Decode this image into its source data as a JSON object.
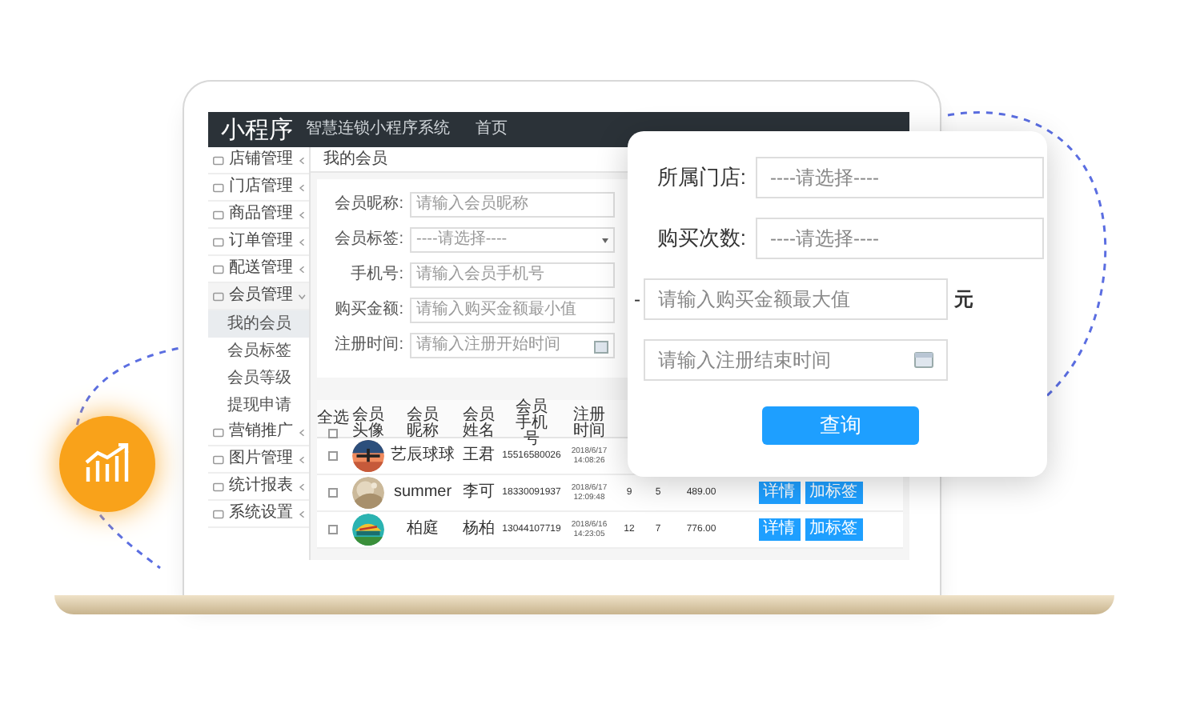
{
  "app": {
    "logo": "小程序",
    "subtitle": "智慧连锁小程序系统",
    "nav": "首页"
  },
  "sidebar": {
    "items": [
      {
        "label": "店铺管理",
        "expanded": false
      },
      {
        "label": "门店管理",
        "expanded": false
      },
      {
        "label": "商品管理",
        "expanded": false
      },
      {
        "label": "订单管理",
        "expanded": false
      },
      {
        "label": "配送管理",
        "expanded": false
      },
      {
        "label": "会员管理",
        "expanded": true,
        "children": [
          {
            "label": "我的会员",
            "selected": true
          },
          {
            "label": "会员标签",
            "selected": false
          },
          {
            "label": "会员等级",
            "selected": false
          },
          {
            "label": "提现申请",
            "selected": false
          }
        ]
      },
      {
        "label": "营销推广",
        "expanded": false
      },
      {
        "label": "图片管理",
        "expanded": false
      },
      {
        "label": "统计报表",
        "expanded": false
      },
      {
        "label": "系统设置",
        "expanded": false
      }
    ]
  },
  "breadcrumb": "我的会员",
  "filter_form": {
    "fields": [
      {
        "label": "会员昵称:",
        "placeholder": "请输入会员昵称",
        "kind": "text"
      },
      {
        "label": "会员标签:",
        "placeholder": "----请选择----",
        "kind": "select"
      },
      {
        "label": "手机号:",
        "placeholder": "请输入会员手机号",
        "kind": "text"
      },
      {
        "label": "购买金额:",
        "placeholder": "请输入购买金额最小值",
        "kind": "text"
      },
      {
        "label": "注册时间:",
        "placeholder": "请输入注册开始时间",
        "kind": "date"
      }
    ]
  },
  "table": {
    "select_all": {
      "label": "全选",
      "checked": false
    },
    "columns": [
      "会员头像",
      "会员昵称",
      "会员姓名",
      "会员手机号",
      "注册时间"
    ],
    "rows": [
      {
        "checked": false,
        "nickname": "艺辰球球",
        "name": "王君",
        "phone": "15516580026",
        "registered": "2018/6/17 14:08:26"
      },
      {
        "checked": false,
        "nickname": "summer",
        "name": "李可",
        "phone": "18330091937",
        "registered": "2018/6/17 12:09:48",
        "column_7": "9",
        "column_8": "5",
        "column_9": "489.00",
        "actions": [
          "详情",
          "加标签"
        ]
      },
      {
        "checked": false,
        "nickname": "柏庭",
        "name": "杨柏",
        "phone": "13044107719",
        "registered": "2018/6/16 14:23:05",
        "column_7": "12",
        "column_8": "7",
        "column_9": "776.00",
        "actions": [
          "详情",
          "加标签"
        ]
      }
    ]
  },
  "popup": {
    "fields": [
      {
        "label": "所属门店:",
        "placeholder": "----请选择----",
        "kind": "select"
      },
      {
        "label": "购买次数:",
        "placeholder": "----请选择----",
        "kind": "select"
      },
      {
        "prefix": "-",
        "placeholder": "请输入购买金额最大值",
        "suffix": "元",
        "kind": "text"
      },
      {
        "placeholder": "请输入注册结束时间",
        "kind": "date"
      }
    ],
    "button": "查询"
  }
}
